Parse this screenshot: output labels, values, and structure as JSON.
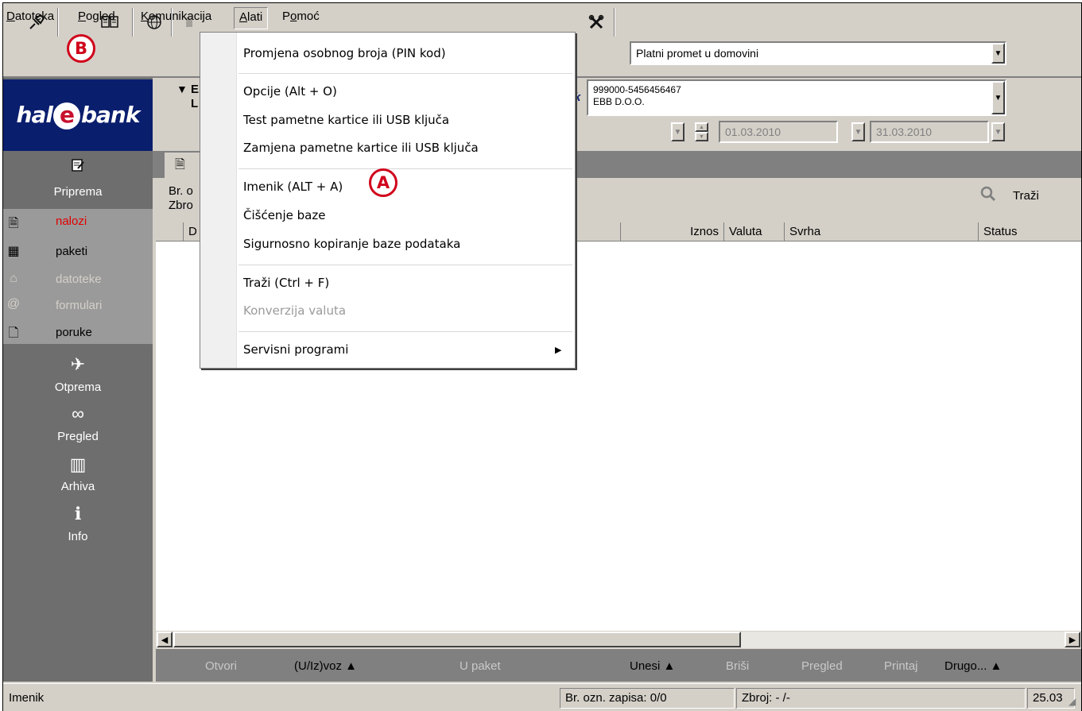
{
  "menubar": {
    "items": [
      {
        "accel": "D",
        "rest": "atoteka"
      },
      {
        "accel": "P",
        "rest": "ogled"
      },
      {
        "accel": "K",
        "rest": "omunikacija"
      },
      {
        "accel": "A",
        "rest": "lati"
      },
      {
        "accel": "P",
        "rest": "omoć",
        "pre": "P",
        "accel_mid": "o",
        "post": "moć"
      }
    ]
  },
  "toolbar": {
    "payment_type": "Platni promet u domovini",
    "account_number": "999000-5456456467",
    "account_name": "EBB D.O.O.",
    "date_from": "01.03.2010",
    "date_to": "31.03.2010",
    "section_heading_prefix_1": "E",
    "section_heading_prefix_2": "L"
  },
  "logo": {
    "pre": "hal",
    "ring": "e",
    "post": "bank"
  },
  "sidebar": {
    "priprema": "Priprema",
    "otprema": "Otprema",
    "pregled": "Pregled",
    "arhiva": "Arhiva",
    "info": "Info",
    "sub_items": [
      "nalozi",
      "paketi",
      "datoteke",
      "formulari",
      "poruke"
    ]
  },
  "info_area": {
    "line1_prefix": "Br. o",
    "line2_prefix": "Zbro",
    "search_label": "Traži"
  },
  "grid": {
    "columns": [
      "D",
      "Iznos",
      "Valuta",
      "Svrha",
      "Status"
    ]
  },
  "actions": {
    "otvori": "Otvori",
    "uizvoz": "(U/Iz)voz ▲",
    "upaket": "U paket",
    "unesi": "Unesi ▲",
    "brisi": "Briši",
    "pregled": "Pregled",
    "printaj": "Printaj",
    "drugo": "Drugo... ▲"
  },
  "statusbar": {
    "left": "Imenik",
    "records": "Br. ozn. zapisa: 0/0",
    "total": "Zbroj: - /-",
    "right": "25.03"
  },
  "dropdown": {
    "items": [
      "Promjena osobnog broja (PIN kod)",
      "Opcije (Alt + O)",
      "Test pametne kartice ili USB ključa",
      "Zamjena pametne kartice ili USB ključa",
      "Imenik (ALT + A)",
      "Čišćenje baze",
      "Sigurnosno kopiranje baze podataka",
      "Traži (Ctrl + F)",
      "Konverzija valuta",
      "Servisni programi"
    ],
    "submenu_arrow": "▶"
  },
  "callouts": {
    "a": "A",
    "b": "B"
  },
  "colors": {
    "accent_red": "#d0021b",
    "sidebar_gray": "#6e6e6e",
    "logo_navy": "#0a1e6e"
  }
}
